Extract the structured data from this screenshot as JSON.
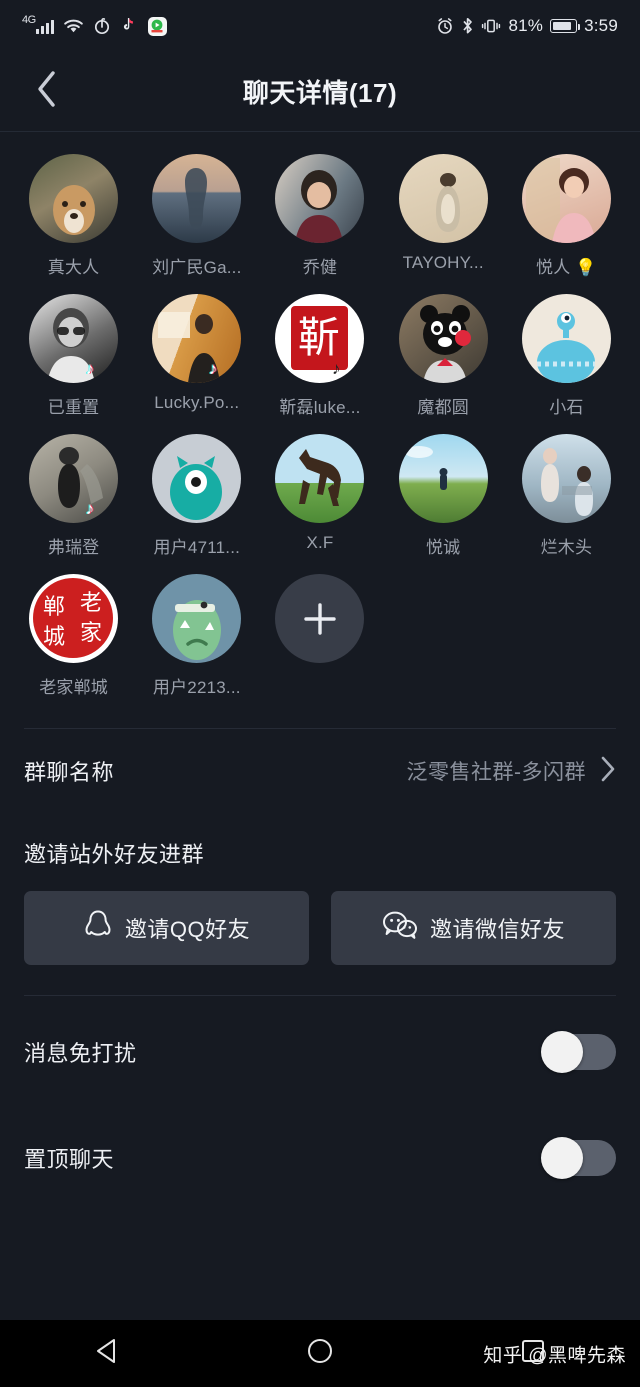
{
  "status_bar": {
    "network_label": "4G",
    "battery_percent": "81%",
    "time": "3:59",
    "icons_left": [
      "signal-bars-icon",
      "wifi-icon",
      "netease-music-icon",
      "tiktok-icon",
      "app-icon"
    ],
    "icons_right": [
      "alarm-icon",
      "bluetooth-icon",
      "vibrate-icon",
      "battery-icon"
    ]
  },
  "header": {
    "back_icon": "chevron-left-icon",
    "title": "聊天详情(17)"
  },
  "members": [
    {
      "name": "真大人",
      "avatar": "dog-photo",
      "badge": ""
    },
    {
      "name": "刘广民Ga...",
      "avatar": "silhouette-sunset",
      "badge": ""
    },
    {
      "name": "乔健",
      "avatar": "woman-photo",
      "badge": ""
    },
    {
      "name": "TAYOHY...",
      "avatar": "beige-painting",
      "badge": ""
    },
    {
      "name": "悦人 💡",
      "avatar": "portrait-pink",
      "badge": ""
    },
    {
      "name": "已重置",
      "avatar": "bw-man-glasses",
      "badge": "tiktok"
    },
    {
      "name": "Lucky.Po...",
      "avatar": "speaker-stage",
      "badge": "tiktok"
    },
    {
      "name": "靳磊luke...",
      "avatar": "red-seal-stamp",
      "badge": "tiktok"
    },
    {
      "name": "魔都圆",
      "avatar": "kumamon-bear",
      "badge": ""
    },
    {
      "name": "小石",
      "avatar": "blue-creature",
      "badge": ""
    },
    {
      "name": "弗瑞登",
      "avatar": "person-walking",
      "badge": "tiktok"
    },
    {
      "name": "用户4711...",
      "avatar": "teal-monster",
      "badge": ""
    },
    {
      "name": "X.F",
      "avatar": "horse-photo",
      "badge": ""
    },
    {
      "name": "悦诚",
      "avatar": "field-sky",
      "badge": ""
    },
    {
      "name": "烂木头",
      "avatar": "two-people-dock",
      "badge": ""
    },
    {
      "name": "老家郸城",
      "avatar": "red-seal-text",
      "badge": ""
    },
    {
      "name": "用户2213...",
      "avatar": "green-monster",
      "badge": ""
    }
  ],
  "add_member": {
    "icon": "plus-icon",
    "label": ""
  },
  "group_name_row": {
    "label": "群聊名称",
    "value": "泛零售社群-多闪群",
    "chevron": "chevron-right-icon"
  },
  "invite_section": {
    "title": "邀请站外好友进群",
    "buttons": [
      {
        "label": "邀请QQ好友",
        "icon": "qq-penguin-icon"
      },
      {
        "label": "邀请微信好友",
        "icon": "wechat-bubbles-icon"
      }
    ]
  },
  "settings": [
    {
      "label": "消息免打扰",
      "toggle_on": false
    },
    {
      "label": "置顶聊天",
      "toggle_on": false
    }
  ],
  "nav_bar": {
    "back_icon": "triangle-back-icon",
    "home_icon": "circle-home-icon",
    "recents_icon": "square-recents-icon",
    "watermark": "知乎 @黑啤先森"
  },
  "colors": {
    "background": "#161a22",
    "surface": "#353a45",
    "text_primary": "#eef0f4",
    "text_secondary": "#8b919d",
    "toggle_track": "#5b616d",
    "toggle_knob": "#f2f2f2",
    "add_button": "#383d48"
  }
}
